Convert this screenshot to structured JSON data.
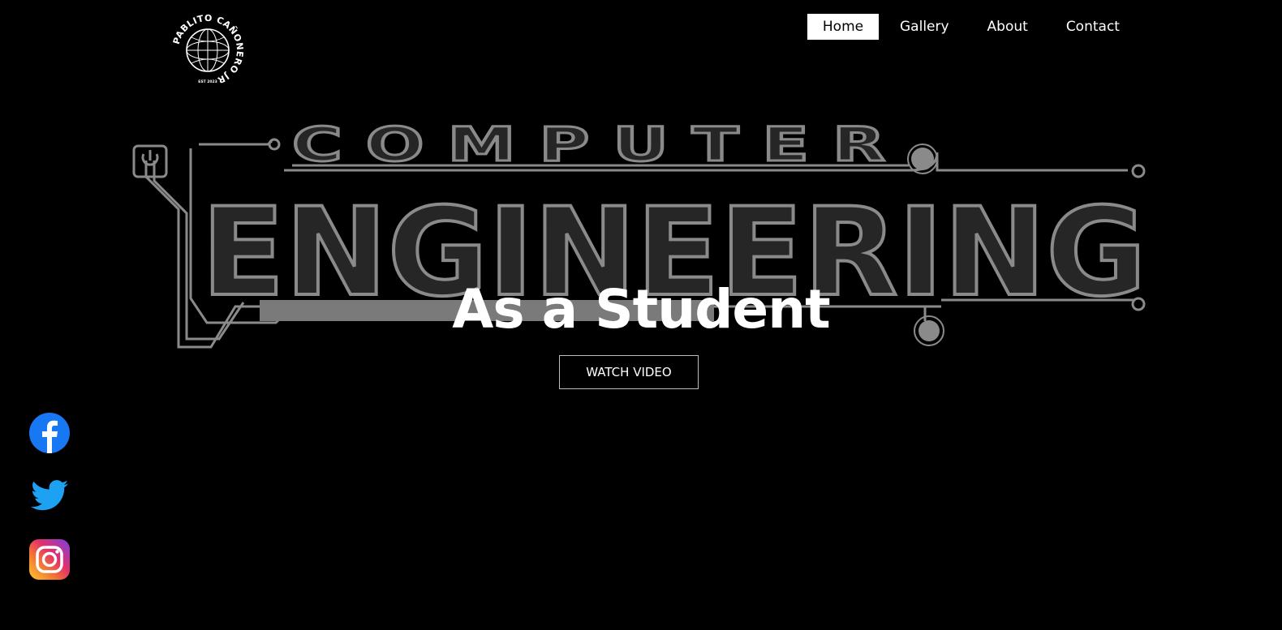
{
  "logo": {
    "text": "PABLITO CAÑONERO JR",
    "est": "EST 2023"
  },
  "nav": {
    "items": [
      {
        "label": "Home",
        "active": true
      },
      {
        "label": "Gallery",
        "active": false
      },
      {
        "label": "About",
        "active": false
      },
      {
        "label": "Contact",
        "active": false
      }
    ]
  },
  "hero": {
    "banner_top": "COMPUTER",
    "banner_main": "ENGINEERING",
    "title": "As a Student",
    "button_label": "WATCH VIDEO"
  },
  "social": [
    {
      "name": "facebook",
      "icon": "facebook-icon",
      "color": "#1877F2"
    },
    {
      "name": "twitter",
      "icon": "twitter-icon",
      "color": "#1DA1F2"
    },
    {
      "name": "instagram",
      "icon": "instagram-icon",
      "color": "#E1306C"
    }
  ],
  "colors": {
    "background": "#000000",
    "text": "#FFFFFF",
    "banner_outline": "#8A8A8A",
    "banner_fill": "#2A2A2A"
  }
}
